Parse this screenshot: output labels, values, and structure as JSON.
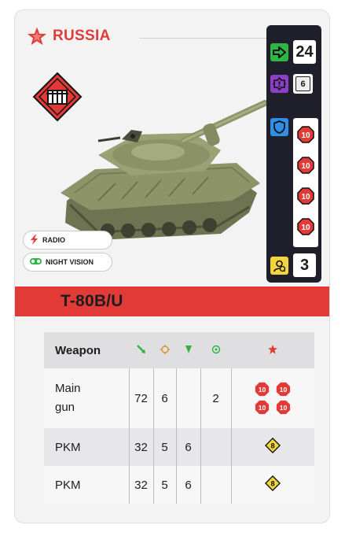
{
  "nation": {
    "name": "RUSSIA"
  },
  "unit": {
    "name": "T-80B/U",
    "type_icon": "armor-gate-icon"
  },
  "stats": {
    "speed": "24",
    "spotting": "6",
    "armor": [
      "10",
      "10",
      "10",
      "10"
    ],
    "health": "3"
  },
  "badges": [
    {
      "label": "RADIO",
      "icon": "lightning-icon"
    },
    {
      "label": "NIGHT VISION",
      "icon": "binoculars-icon"
    }
  ],
  "weapons_table": {
    "header": "Weapon",
    "columns_icons": [
      "range-icon",
      "aim-icon",
      "penetration-icon",
      "rate-icon",
      "damage-icon"
    ],
    "rows": [
      {
        "name": "Main gun",
        "range": "72",
        "aim": "6",
        "pen": "",
        "rate": "2",
        "ammo": [
          "10",
          "10",
          "10",
          "10"
        ],
        "ammo_color": "red"
      },
      {
        "name": "PKM",
        "range": "32",
        "aim": "5",
        "pen": "6",
        "rate": "",
        "ammo": [
          "8"
        ],
        "ammo_color": "yellow"
      },
      {
        "name": "PKM",
        "range": "32",
        "aim": "5",
        "pen": "6",
        "rate": "",
        "ammo": [
          "8"
        ],
        "ammo_color": "yellow"
      }
    ]
  },
  "colors": {
    "accent_red": "#e23b37",
    "speed_green": "#2fb544",
    "spot_purple": "#8c3fc6",
    "armor_blue": "#2f8fe8",
    "health_yellow": "#f2d43d",
    "ammo_red": "#e23b37",
    "ammo_yellow": "#f2d43d"
  }
}
